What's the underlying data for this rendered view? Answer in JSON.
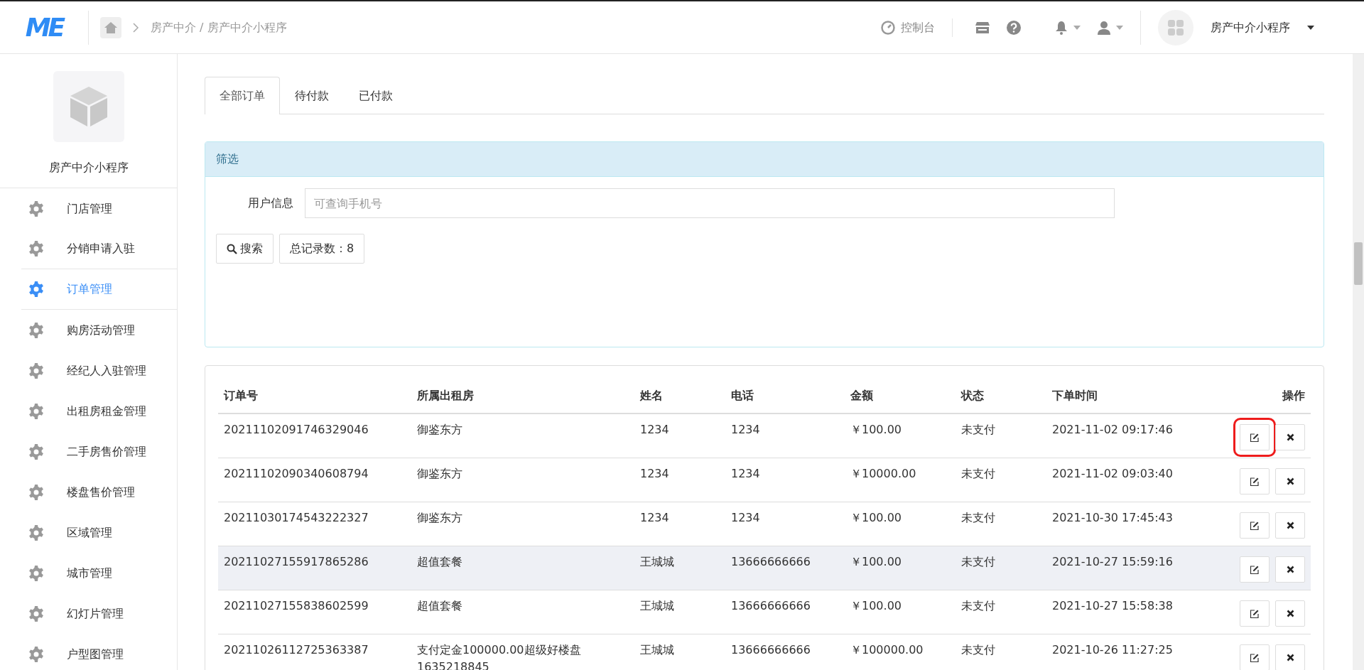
{
  "header": {
    "logo": "ME",
    "breadcrumb": "房产中介 / 房产中介小程序",
    "console": "控制台",
    "account": "房产中介小程序"
  },
  "sidebar": {
    "title": "房产中介小程序",
    "items": [
      {
        "label": "门店管理",
        "selected": false
      },
      {
        "label": "分销申请入驻",
        "selected": false
      },
      {
        "label": "订单管理",
        "selected": true
      },
      {
        "label": "购房活动管理",
        "selected": false
      },
      {
        "label": "经纪人入驻管理",
        "selected": false
      },
      {
        "label": "出租房租金管理",
        "selected": false
      },
      {
        "label": "二手房售价管理",
        "selected": false
      },
      {
        "label": "楼盘售价管理",
        "selected": false
      },
      {
        "label": "区域管理",
        "selected": false
      },
      {
        "label": "城市管理",
        "selected": false
      },
      {
        "label": "幻灯片管理",
        "selected": false
      },
      {
        "label": "户型图管理",
        "selected": false
      }
    ]
  },
  "tabs": [
    {
      "label": "全部订单",
      "selected": true
    },
    {
      "label": "待付款",
      "selected": false
    },
    {
      "label": "已付款",
      "selected": false
    }
  ],
  "filter": {
    "title": "筛选",
    "field_label": "用户信息",
    "placeholder": "可查询手机号",
    "search_button": "搜索",
    "total": "总记录数：8"
  },
  "table": {
    "columns": [
      "订单号",
      "所属出租房",
      "姓名",
      "电话",
      "金额",
      "状态",
      "下单时间",
      "操作"
    ],
    "rows": [
      {
        "cells": [
          "20211102091746329046",
          "御鉴东方",
          "1234",
          "1234",
          "￥100.00",
          "未支付",
          "2021-11-02 09:17:46"
        ],
        "hovered": false,
        "highlighted": true
      },
      {
        "cells": [
          "20211102090340608794",
          "御鉴东方",
          "1234",
          "1234",
          "￥10000.00",
          "未支付",
          "2021-11-02 09:03:40"
        ],
        "hovered": false,
        "highlighted": false
      },
      {
        "cells": [
          "20211030174543222327",
          "御鉴东方",
          "1234",
          "1234",
          "￥100.00",
          "未支付",
          "2021-10-30 17:45:43"
        ],
        "hovered": false,
        "highlighted": false
      },
      {
        "cells": [
          "20211027155917865286",
          "超值套餐",
          "王城城",
          "13666666666",
          "￥100.00",
          "未支付",
          "2021-10-27 15:59:16"
        ],
        "hovered": true,
        "highlighted": false
      },
      {
        "cells": [
          "20211027155838602599",
          "超值套餐",
          "王城城",
          "13666666666",
          "￥100.00",
          "未支付",
          "2021-10-27 15:58:38"
        ],
        "hovered": false,
        "highlighted": false
      },
      {
        "cells": [
          "20211026112725363387",
          "支付定金100000.00超级好楼盘1635218845",
          "王城城",
          "13666666666",
          "￥100000.00",
          "未支付",
          "2021-10-26 11:27:25"
        ],
        "hovered": false,
        "highlighted": false
      }
    ]
  }
}
